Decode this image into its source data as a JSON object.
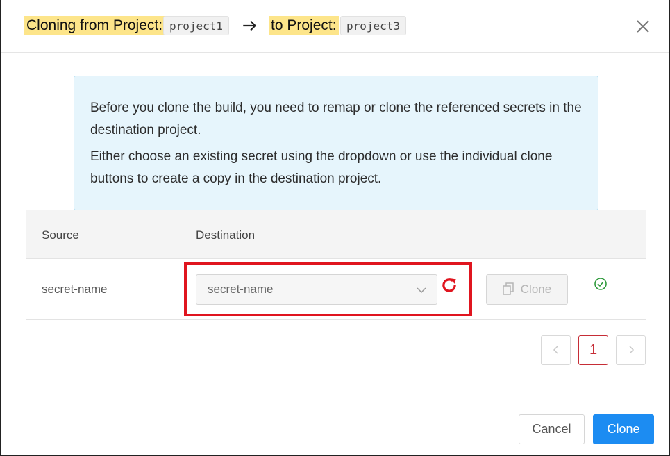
{
  "header": {
    "from_label": "Cloning from Project:",
    "from_project": "project1",
    "to_label": "to Project:",
    "to_project": "project3",
    "close_icon": "close-icon"
  },
  "info": {
    "line1": "Before you clone the build, you need to remap or clone the referenced secrets in the destination project.",
    "line2": "Either choose an existing secret using the dropdown or use the individual clone buttons to create a copy in the destination project."
  },
  "table": {
    "columns": [
      "Source",
      "Destination"
    ],
    "rows": [
      {
        "source": "secret-name",
        "destination": "secret-name",
        "clone_label": "Clone",
        "status": "check-circle-icon"
      }
    ]
  },
  "pagination": {
    "current_page": "1"
  },
  "footer": {
    "cancel_label": "Cancel",
    "clone_label": "Clone"
  },
  "colors": {
    "highlight": "#fde58a",
    "info_bg": "#e6f5fc",
    "primary": "#1c8cf2",
    "danger": "#e0151f",
    "success": "#2e9a3b"
  }
}
